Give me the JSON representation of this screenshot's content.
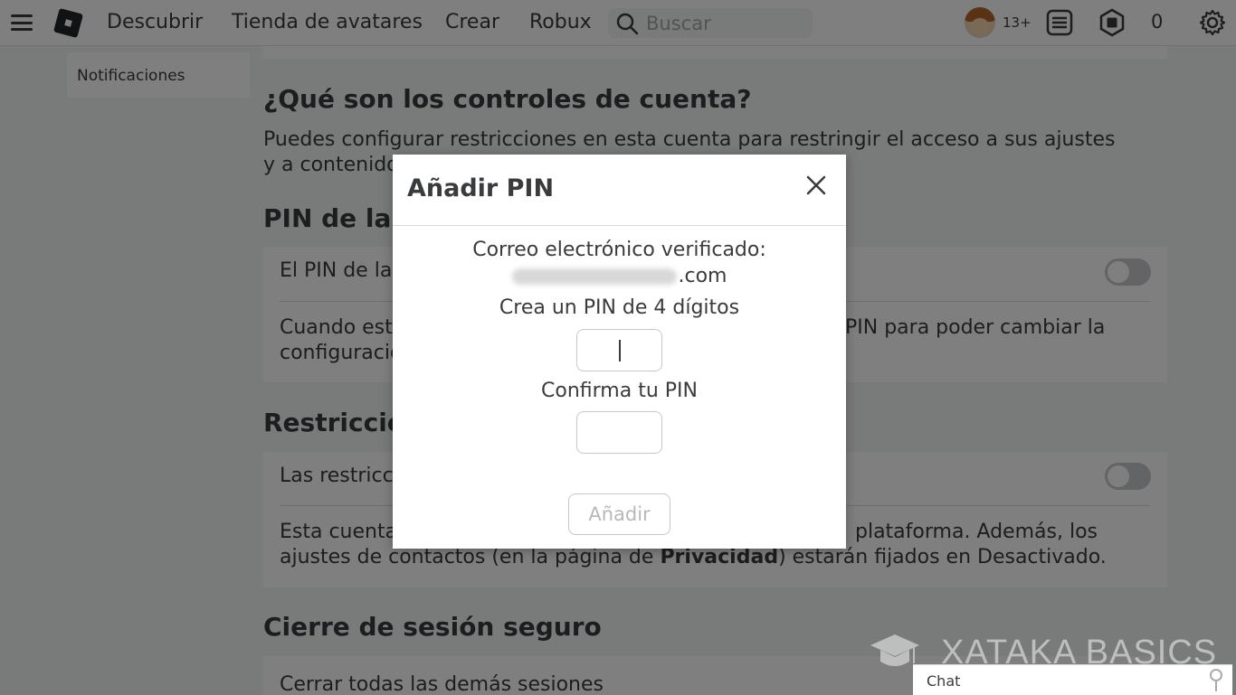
{
  "nav": {
    "links": [
      "Descubrir",
      "Tienda de avatares",
      "Crear",
      "Robux"
    ],
    "search_placeholder": "Buscar",
    "age_badge": "13+",
    "robux_count": "0"
  },
  "sidebar": {
    "items": [
      "Notificaciones"
    ]
  },
  "main": {
    "controls_title": "¿Qué son los controles de cuenta?",
    "controls_desc": "Puedes configurar restricciones en esta cuenta para restringir el acceso a sus ajustes y a contenidos no",
    "pin_title": "PIN de la c",
    "pin_row": "El PIN de la",
    "pin_desc_left": "Cuando esta",
    "pin_desc_right": "PIN para poder cambiar la",
    "pin_desc_line2": "configuracio",
    "restrictions_title": "Restriccio",
    "restrictions_row": "Las restricc",
    "restrictions_desc_left": "Esta cuenta",
    "restrictions_desc_right": "plataforma. Además, los",
    "restrictions_desc_line2_a": "ajustes de contactos (en la página de ",
    "restrictions_desc_line2_bold": "Privacidad",
    "restrictions_desc_line2_b": ") estarán fijados en Desactivado.",
    "logout_title": "Cierre de sesión seguro",
    "logout_row": "Cerrar todas las demás sesiones"
  },
  "modal": {
    "title": "Añadir PIN",
    "verified_label": "Correo electrónico verificado:",
    "email_suffix": ".com",
    "create_pin_label": "Crea un PIN de 4 dígitos",
    "confirm_pin_label": "Confirma tu PIN",
    "add_button": "Añadir"
  },
  "watermark": "XATAKA BASICS",
  "chat": "Chat",
  "colors": {
    "overlay": "rgba(0,0,0,0.5)",
    "toggle_off": "#c6c8ca",
    "text": "#393b3d"
  }
}
